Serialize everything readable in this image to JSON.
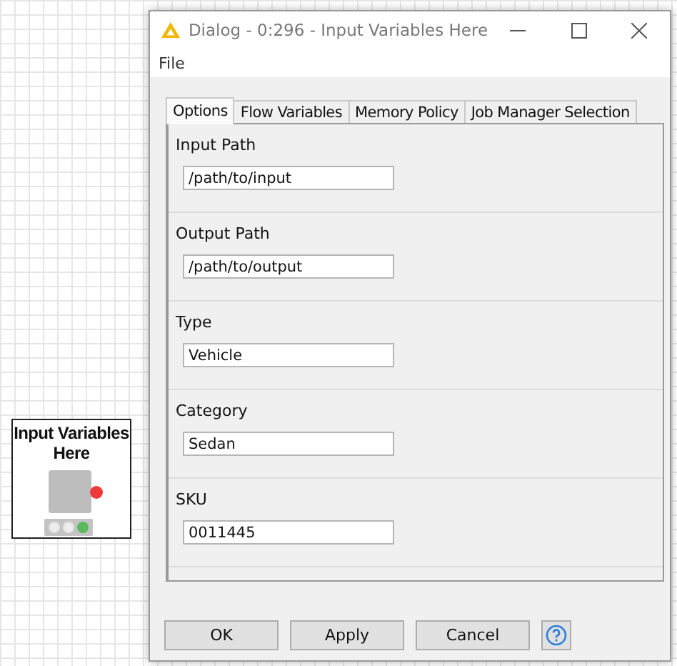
{
  "node": {
    "title": "Input Variables Here",
    "ports": [
      {
        "color": "#ee3a3a"
      }
    ],
    "lights": [
      {
        "color": "#e0e0e0",
        "on": false
      },
      {
        "color": "#e0e0e0",
        "on": false
      },
      {
        "color": "#5cb85c",
        "on": true
      }
    ]
  },
  "dialog": {
    "title": "Dialog - 0:296 - Input Variables Here",
    "menu": [
      "File"
    ],
    "tabs": [
      {
        "label": "Options",
        "selected": true
      },
      {
        "label": "Flow Variables",
        "selected": false
      },
      {
        "label": "Memory Policy",
        "selected": false
      },
      {
        "label": "Job Manager Selection",
        "selected": false
      }
    ],
    "fields": [
      {
        "label": "Input Path",
        "value": "/path/to/input"
      },
      {
        "label": "Output Path",
        "value": "/path/to/output"
      },
      {
        "label": "Type",
        "value": "Vehicle"
      },
      {
        "label": "Category",
        "value": "Sedan"
      },
      {
        "label": "SKU",
        "value": "0011445"
      }
    ],
    "buttons": [
      "OK",
      "Apply",
      "Cancel"
    ]
  }
}
